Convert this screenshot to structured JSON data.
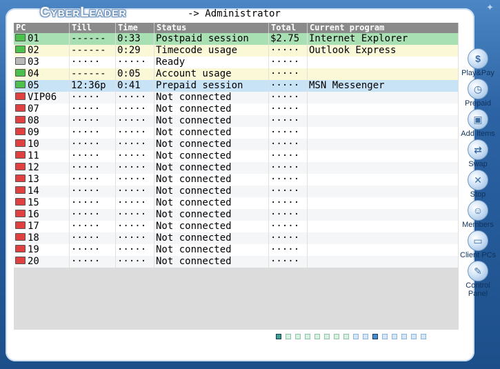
{
  "app": {
    "logo_text": "CyberLeader",
    "user_line": "-> Administrator"
  },
  "table": {
    "columns": [
      "PC",
      "Till",
      "Time",
      "Status",
      "Total",
      "Current program"
    ],
    "rows": [
      {
        "pc": "01",
        "state": "green",
        "row": "r-green",
        "till": "------",
        "time": "0:33",
        "status": "Postpaid session",
        "total": "$2.75",
        "program": "Internet Explorer"
      },
      {
        "pc": "02",
        "state": "green",
        "row": "r-yellow",
        "till": "------",
        "time": "0:29",
        "status": "Timecode usage",
        "total": "·····",
        "program": "Outlook Express"
      },
      {
        "pc": "03",
        "state": "grey",
        "row": "r-grey",
        "till": "·····",
        "time": "·····",
        "status": "Ready",
        "total": "·····",
        "program": ""
      },
      {
        "pc": "04",
        "state": "green",
        "row": "r-yellow",
        "till": "------",
        "time": "0:05",
        "status": "Account usage",
        "total": "·····",
        "program": ""
      },
      {
        "pc": "05",
        "state": "green",
        "row": "r-blue",
        "till": "12:36p",
        "time": "0:41",
        "status": "Prepaid session",
        "total": "·····",
        "program": "MSN Messenger"
      },
      {
        "pc": "VIP06",
        "state": "red",
        "row": "r-white",
        "till": "·····",
        "time": "·····",
        "status": "Not connected",
        "total": "·····",
        "program": ""
      },
      {
        "pc": "07",
        "state": "red",
        "row": "r-white",
        "till": "·····",
        "time": "·····",
        "status": "Not connected",
        "total": "·····",
        "program": ""
      },
      {
        "pc": "08",
        "state": "red",
        "row": "r-white",
        "till": "·····",
        "time": "·····",
        "status": "Not connected",
        "total": "·····",
        "program": ""
      },
      {
        "pc": "09",
        "state": "red",
        "row": "r-white",
        "till": "·····",
        "time": "·····",
        "status": "Not connected",
        "total": "·····",
        "program": ""
      },
      {
        "pc": "10",
        "state": "red",
        "row": "r-white",
        "till": "·····",
        "time": "·····",
        "status": "Not connected",
        "total": "·····",
        "program": ""
      },
      {
        "pc": "11",
        "state": "red",
        "row": "r-white",
        "till": "·····",
        "time": "·····",
        "status": "Not connected",
        "total": "·····",
        "program": ""
      },
      {
        "pc": "12",
        "state": "red",
        "row": "r-white",
        "till": "·····",
        "time": "·····",
        "status": "Not connected",
        "total": "·····",
        "program": ""
      },
      {
        "pc": "13",
        "state": "red",
        "row": "r-white",
        "till": "·····",
        "time": "·····",
        "status": "Not connected",
        "total": "·····",
        "program": ""
      },
      {
        "pc": "14",
        "state": "red",
        "row": "r-white",
        "till": "·····",
        "time": "·····",
        "status": "Not connected",
        "total": "·····",
        "program": ""
      },
      {
        "pc": "15",
        "state": "red",
        "row": "r-white",
        "till": "·····",
        "time": "·····",
        "status": "Not connected",
        "total": "·····",
        "program": ""
      },
      {
        "pc": "16",
        "state": "red",
        "row": "r-white",
        "till": "·····",
        "time": "·····",
        "status": "Not connected",
        "total": "·····",
        "program": ""
      },
      {
        "pc": "17",
        "state": "red",
        "row": "r-white",
        "till": "·····",
        "time": "·····",
        "status": "Not connected",
        "total": "·····",
        "program": ""
      },
      {
        "pc": "18",
        "state": "red",
        "row": "r-white",
        "till": "·····",
        "time": "·····",
        "status": "Not connected",
        "total": "·····",
        "program": ""
      },
      {
        "pc": "19",
        "state": "red",
        "row": "r-white",
        "till": "·····",
        "time": "·····",
        "status": "Not connected",
        "total": "·····",
        "program": ""
      },
      {
        "pc": "20",
        "state": "red",
        "row": "r-white",
        "till": "·····",
        "time": "·····",
        "status": "Not connected",
        "total": "·····",
        "program": ""
      }
    ]
  },
  "sidebar": {
    "items": [
      {
        "name": "play-pay",
        "label": "Play&Pay",
        "icon": "dollar-icon",
        "glyph": "$"
      },
      {
        "name": "prepaid",
        "label": "Prepaid",
        "icon": "clock-icon",
        "glyph": "◷"
      },
      {
        "name": "add-items",
        "label": "Add Items",
        "icon": "box-icon",
        "glyph": "▣"
      },
      {
        "name": "swap",
        "label": "Swap",
        "icon": "swap-icon",
        "glyph": "⇄"
      },
      {
        "name": "stop",
        "label": "Stop",
        "icon": "stop-icon",
        "glyph": "✕"
      },
      {
        "name": "members",
        "label": "Members",
        "icon": "members-icon",
        "glyph": "☺"
      },
      {
        "name": "client-pcs",
        "label": "Client PCs",
        "icon": "computer-icon",
        "glyph": "▭"
      },
      {
        "name": "control-panel",
        "label": "Control Panel",
        "icon": "wrench-icon",
        "glyph": "✎"
      }
    ]
  },
  "pager": {
    "pages": [
      "on",
      "g",
      "g",
      "g",
      "g",
      "g",
      "g",
      "g",
      "b",
      "b",
      "on2",
      "b",
      "b",
      "b",
      "b",
      "b"
    ]
  },
  "colors": {
    "frame": "#2c63a4",
    "header_bg": "#8a8a8a",
    "row_green": "#a8e0b4",
    "row_yellow": "#fbf8d8",
    "row_blue": "#c8e2f6",
    "status_red": "#e04040",
    "status_green": "#4cc04c"
  }
}
